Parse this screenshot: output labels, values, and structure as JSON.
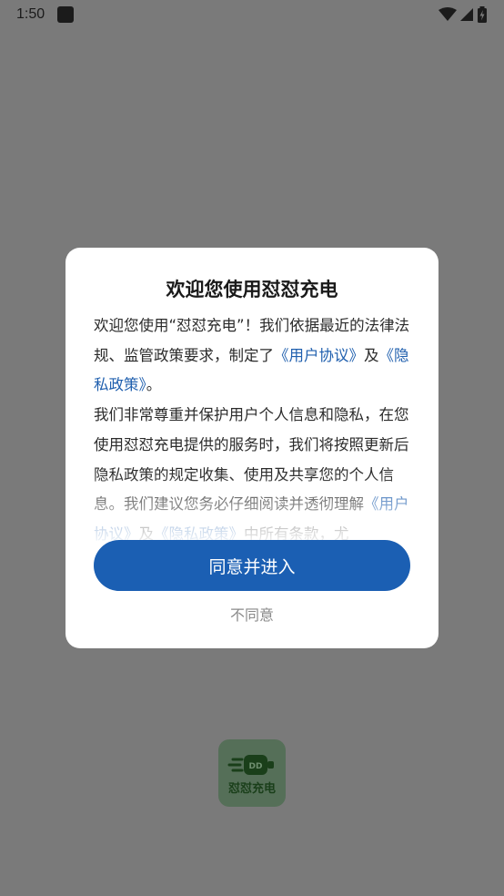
{
  "status_bar": {
    "time": "1:50"
  },
  "dialog": {
    "title": "欢迎您使用怼怼充电",
    "p1_intro": "欢迎您使用“怼怼充电”！我们依据最近的法律法规、监管政策要求，制定了",
    "p1_link_user": "《用户协议》",
    "p1_and": "及",
    "p1_link_privacy": "《隐私政策》",
    "p1_end": "。",
    "p2": "我们非常尊重并保护用户个人信息和隐私，在您使用怼怼充电提供的服务时，我们将按照更新后隐私政策的规定收集、使用及共享您的个人信息。我们建议您务必仔细阅读并透彻理解",
    "p2_link_user": "《用户协议》",
    "p2_and": "及",
    "p2_link_privacy": "《隐私政策》",
    "p2_end": "中所有条款，尤",
    "agree_label": "同意并进入",
    "disagree_label": "不同意"
  },
  "splash": {
    "logo_text": "怼怼充电",
    "logo_badge": "DD"
  },
  "colors": {
    "accent": "#1b5fb3",
    "link": "#1f5fae",
    "overlay": "#7a7a7a"
  }
}
